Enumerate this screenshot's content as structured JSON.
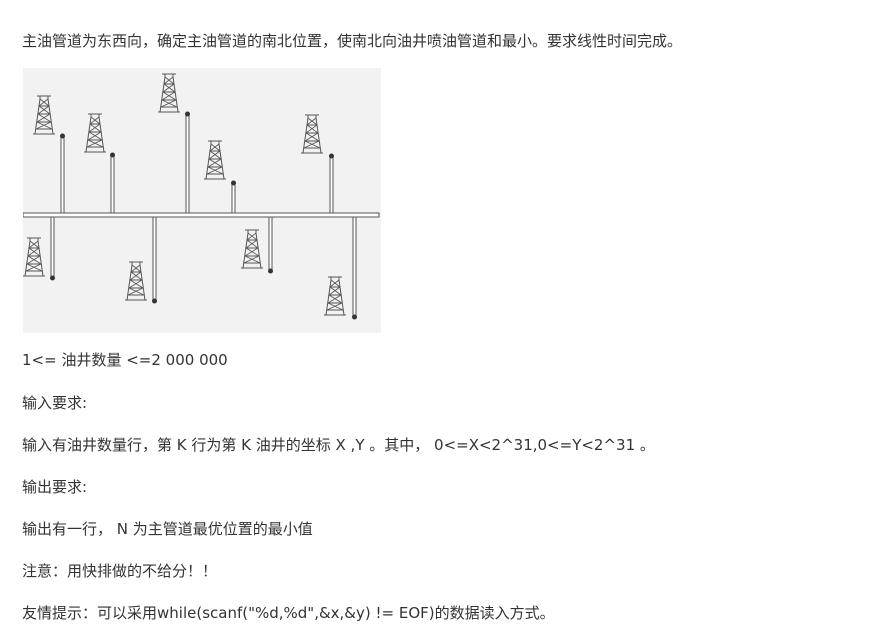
{
  "problem": {
    "intro": "主油管道为东西向，确定主油管道的南北位置，使南北向油井喷油管道和最小。要求线性时间完成。",
    "constraint": "1<= 油井数量 <=2 000 000",
    "input_title": "输入要求:",
    "input_body": "输入有油井数量行，第 K 行为第 K 油井的坐标 X ,Y 。其中， 0<=X<2^31,0<=Y<2^31 。",
    "output_title": "输出要求:",
    "output_body": "输出有一行， N 为主管道最优位置的最小值",
    "note": "注意：用快排做的不给分！！",
    "hint": "友情提示：可以采用while(scanf(\"%d,%d\",&x,&y) != EOF)的数据读入方式。"
  },
  "figure": {
    "icon": "oil-derrick-icon",
    "colors": {
      "background": "#f2f2f2",
      "stroke": "#555555",
      "pipe_fill": "#ffffff"
    }
  }
}
